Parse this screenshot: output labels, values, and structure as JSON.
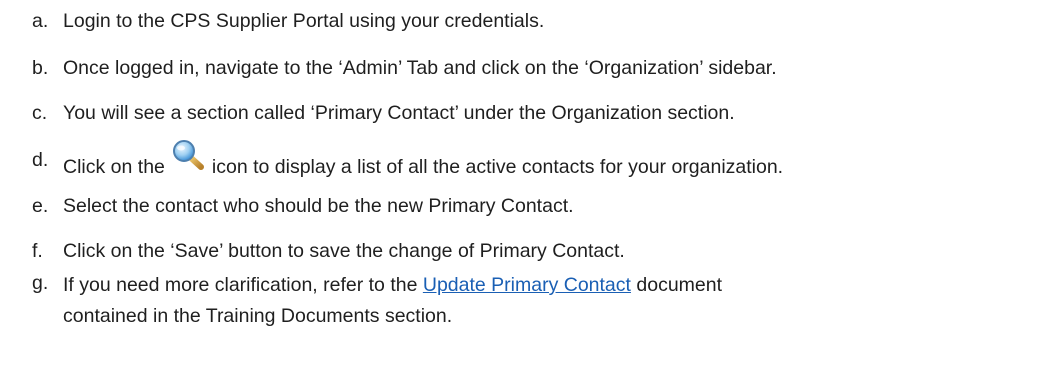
{
  "steps": [
    {
      "marker": "a.",
      "text": "Login to the CPS Supplier Portal using your credentials."
    },
    {
      "marker": "b.",
      "text": "Once logged in, navigate to the ‘Admin’ Tab and click on the ‘Organization’ sidebar."
    },
    {
      "marker": "c.",
      "text": "You will see a section called ‘Primary Contact’ under the Organization section."
    },
    {
      "marker": "d.",
      "text_before": "Click on the",
      "text_after": "icon to display a list of all the active contacts for your organization.",
      "icon": "magnifier-search-icon"
    },
    {
      "marker": "e.",
      "text": "Select the contact who should be the new Primary Contact."
    },
    {
      "marker": "f.",
      "text": "Click on the ‘Save’ button to save the change of Primary Contact."
    },
    {
      "marker": "g.",
      "text_before": "If you need more clarification, refer to the",
      "link": "Update Primary Contact",
      "text_after": "document",
      "text_line2": "contained in the Training Documents section."
    }
  ],
  "colors": {
    "text": "#1f1f1f",
    "link": "#1a5fb4",
    "icon_lens": "#3b8fd6",
    "icon_handle": "#d9a640"
  }
}
